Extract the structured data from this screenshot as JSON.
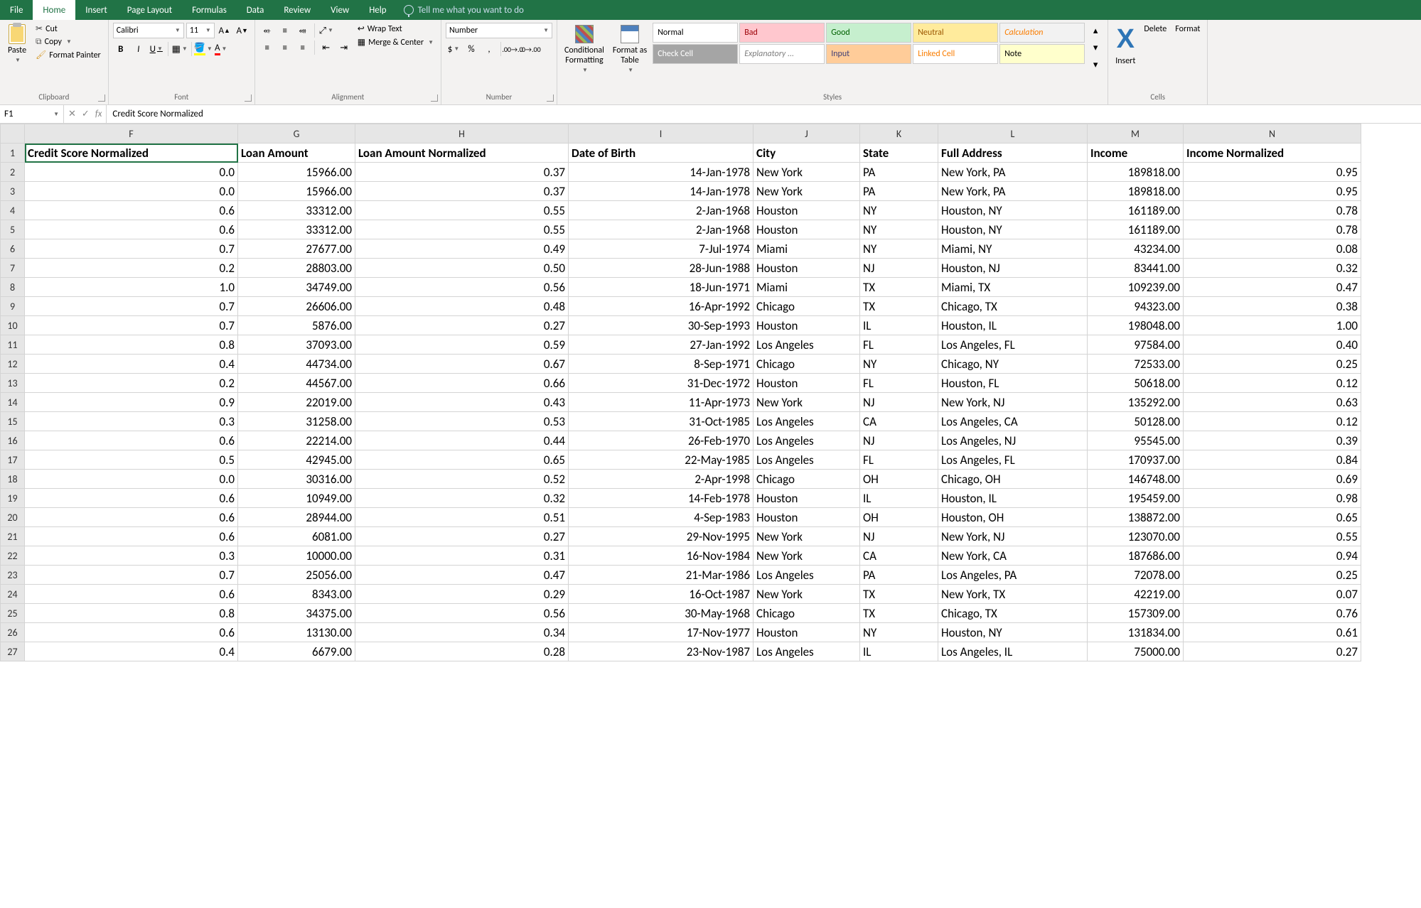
{
  "tabs": {
    "file": "File",
    "home": "Home",
    "insert": "Insert",
    "pageLayout": "Page Layout",
    "formulas": "Formulas",
    "data": "Data",
    "review": "Review",
    "view": "View",
    "help": "Help"
  },
  "tellMe": "Tell me what you want to do",
  "clipboard": {
    "paste": "Paste",
    "cut": "Cut",
    "copy": "Copy",
    "formatPainter": "Format Painter",
    "group": "Clipboard"
  },
  "font": {
    "name": "Calibri",
    "size": "11",
    "bold": "B",
    "italic": "I",
    "underline": "U",
    "group": "Font"
  },
  "alignment": {
    "wrap": "Wrap Text",
    "merge": "Merge & Center",
    "group": "Alignment"
  },
  "number": {
    "format": "Number",
    "group": "Number"
  },
  "cf": {
    "conditional": "Conditional\nFormatting",
    "tableAs": "Format as\nTable"
  },
  "styles": {
    "normal": "Normal",
    "bad": "Bad",
    "good": "Good",
    "neutral": "Neutral",
    "calc": "Calculation",
    "check": "Check Cell",
    "explan": "Explanatory ...",
    "input": "Input",
    "linked": "Linked Cell",
    "note": "Note",
    "group": "Styles"
  },
  "cells": {
    "insert": "Insert",
    "delete": "Delete",
    "format": "Format",
    "group": "Cells"
  },
  "namebox": "F1",
  "formula": "Credit Score Normalized",
  "columns": [
    "F",
    "G",
    "H",
    "I",
    "J",
    "K",
    "L",
    "M",
    "N"
  ],
  "headers": {
    "F": "Credit Score Normalized",
    "G": "Loan Amount",
    "H": "Loan Amount Normalized",
    "I": "Date of Birth",
    "J": "City",
    "K": "State",
    "L": "Full Address",
    "M": "Income",
    "N": "Income Normalized"
  },
  "rows": [
    {
      "n": 2,
      "F": "0.0",
      "G": "15966.00",
      "H": "0.37",
      "I": "14-Jan-1978",
      "J": "New York",
      "K": "PA",
      "L": "New York, PA",
      "M": "189818.00",
      "N": "0.95"
    },
    {
      "n": 3,
      "F": "0.0",
      "G": "15966.00",
      "H": "0.37",
      "I": "14-Jan-1978",
      "J": "New York",
      "K": "PA",
      "L": "New York, PA",
      "M": "189818.00",
      "N": "0.95"
    },
    {
      "n": 4,
      "F": "0.6",
      "G": "33312.00",
      "H": "0.55",
      "I": "2-Jan-1968",
      "J": "Houston",
      "K": "NY",
      "L": "Houston, NY",
      "M": "161189.00",
      "N": "0.78"
    },
    {
      "n": 5,
      "F": "0.6",
      "G": "33312.00",
      "H": "0.55",
      "I": "2-Jan-1968",
      "J": "Houston",
      "K": "NY",
      "L": "Houston, NY",
      "M": "161189.00",
      "N": "0.78"
    },
    {
      "n": 6,
      "F": "0.7",
      "G": "27677.00",
      "H": "0.49",
      "I": "7-Jul-1974",
      "J": "Miami",
      "K": "NY",
      "L": "Miami, NY",
      "M": "43234.00",
      "N": "0.08"
    },
    {
      "n": 7,
      "F": "0.2",
      "G": "28803.00",
      "H": "0.50",
      "I": "28-Jun-1988",
      "J": "Houston",
      "K": "NJ",
      "L": "Houston, NJ",
      "M": "83441.00",
      "N": "0.32"
    },
    {
      "n": 8,
      "F": "1.0",
      "G": "34749.00",
      "H": "0.56",
      "I": "18-Jun-1971",
      "J": "Miami",
      "K": "TX",
      "L": "Miami, TX",
      "M": "109239.00",
      "N": "0.47"
    },
    {
      "n": 9,
      "F": "0.7",
      "G": "26606.00",
      "H": "0.48",
      "I": "16-Apr-1992",
      "J": "Chicago",
      "K": "TX",
      "L": "Chicago, TX",
      "M": "94323.00",
      "N": "0.38"
    },
    {
      "n": 10,
      "F": "0.7",
      "G": "5876.00",
      "H": "0.27",
      "I": "30-Sep-1993",
      "J": "Houston",
      "K": "IL",
      "L": "Houston, IL",
      "M": "198048.00",
      "N": "1.00"
    },
    {
      "n": 11,
      "F": "0.8",
      "G": "37093.00",
      "H": "0.59",
      "I": "27-Jan-1992",
      "J": "Los Angeles",
      "K": "FL",
      "L": "Los Angeles, FL",
      "M": "97584.00",
      "N": "0.40"
    },
    {
      "n": 12,
      "F": "0.4",
      "G": "44734.00",
      "H": "0.67",
      "I": "8-Sep-1971",
      "J": "Chicago",
      "K": "NY",
      "L": "Chicago, NY",
      "M": "72533.00",
      "N": "0.25"
    },
    {
      "n": 13,
      "F": "0.2",
      "G": "44567.00",
      "H": "0.66",
      "I": "31-Dec-1972",
      "J": "Houston",
      "K": "FL",
      "L": "Houston, FL",
      "M": "50618.00",
      "N": "0.12"
    },
    {
      "n": 14,
      "F": "0.9",
      "G": "22019.00",
      "H": "0.43",
      "I": "11-Apr-1973",
      "J": "New York",
      "K": "NJ",
      "L": "New York, NJ",
      "M": "135292.00",
      "N": "0.63"
    },
    {
      "n": 15,
      "F": "0.3",
      "G": "31258.00",
      "H": "0.53",
      "I": "31-Oct-1985",
      "J": "Los Angeles",
      "K": "CA",
      "L": "Los Angeles, CA",
      "M": "50128.00",
      "N": "0.12"
    },
    {
      "n": 16,
      "F": "0.6",
      "G": "22214.00",
      "H": "0.44",
      "I": "26-Feb-1970",
      "J": "Los Angeles",
      "K": "NJ",
      "L": "Los Angeles, NJ",
      "M": "95545.00",
      "N": "0.39"
    },
    {
      "n": 17,
      "F": "0.5",
      "G": "42945.00",
      "H": "0.65",
      "I": "22-May-1985",
      "J": "Los Angeles",
      "K": "FL",
      "L": "Los Angeles, FL",
      "M": "170937.00",
      "N": "0.84"
    },
    {
      "n": 18,
      "F": "0.0",
      "G": "30316.00",
      "H": "0.52",
      "I": "2-Apr-1998",
      "J": "Chicago",
      "K": "OH",
      "L": "Chicago, OH",
      "M": "146748.00",
      "N": "0.69"
    },
    {
      "n": 19,
      "F": "0.6",
      "G": "10949.00",
      "H": "0.32",
      "I": "14-Feb-1978",
      "J": "Houston",
      "K": "IL",
      "L": "Houston, IL",
      "M": "195459.00",
      "N": "0.98"
    },
    {
      "n": 20,
      "F": "0.6",
      "G": "28944.00",
      "H": "0.51",
      "I": "4-Sep-1983",
      "J": "Houston",
      "K": "OH",
      "L": "Houston, OH",
      "M": "138872.00",
      "N": "0.65"
    },
    {
      "n": 21,
      "F": "0.6",
      "G": "6081.00",
      "H": "0.27",
      "I": "29-Nov-1995",
      "J": "New York",
      "K": "NJ",
      "L": "New York, NJ",
      "M": "123070.00",
      "N": "0.55"
    },
    {
      "n": 22,
      "F": "0.3",
      "G": "10000.00",
      "H": "0.31",
      "I": "16-Nov-1984",
      "J": "New York",
      "K": "CA",
      "L": "New York, CA",
      "M": "187686.00",
      "N": "0.94"
    },
    {
      "n": 23,
      "F": "0.7",
      "G": "25056.00",
      "H": "0.47",
      "I": "21-Mar-1986",
      "J": "Los Angeles",
      "K": "PA",
      "L": "Los Angeles, PA",
      "M": "72078.00",
      "N": "0.25"
    },
    {
      "n": 24,
      "F": "0.6",
      "G": "8343.00",
      "H": "0.29",
      "I": "16-Oct-1987",
      "J": "New York",
      "K": "TX",
      "L": "New York, TX",
      "M": "42219.00",
      "N": "0.07"
    },
    {
      "n": 25,
      "F": "0.8",
      "G": "34375.00",
      "H": "0.56",
      "I": "30-May-1968",
      "J": "Chicago",
      "K": "TX",
      "L": "Chicago, TX",
      "M": "157309.00",
      "N": "0.76"
    },
    {
      "n": 26,
      "F": "0.6",
      "G": "13130.00",
      "H": "0.34",
      "I": "17-Nov-1977",
      "J": "Houston",
      "K": "NY",
      "L": "Houston, NY",
      "M": "131834.00",
      "N": "0.61"
    },
    {
      "n": 27,
      "F": "0.4",
      "G": "6679.00",
      "H": "0.28",
      "I": "23-Nov-1987",
      "J": "Los Angeles",
      "K": "IL",
      "L": "Los Angeles, IL",
      "M": "75000.00",
      "N": "0.27"
    }
  ],
  "selected": "F1",
  "numericCols": [
    "F",
    "G",
    "H",
    "I",
    "M",
    "N"
  ]
}
